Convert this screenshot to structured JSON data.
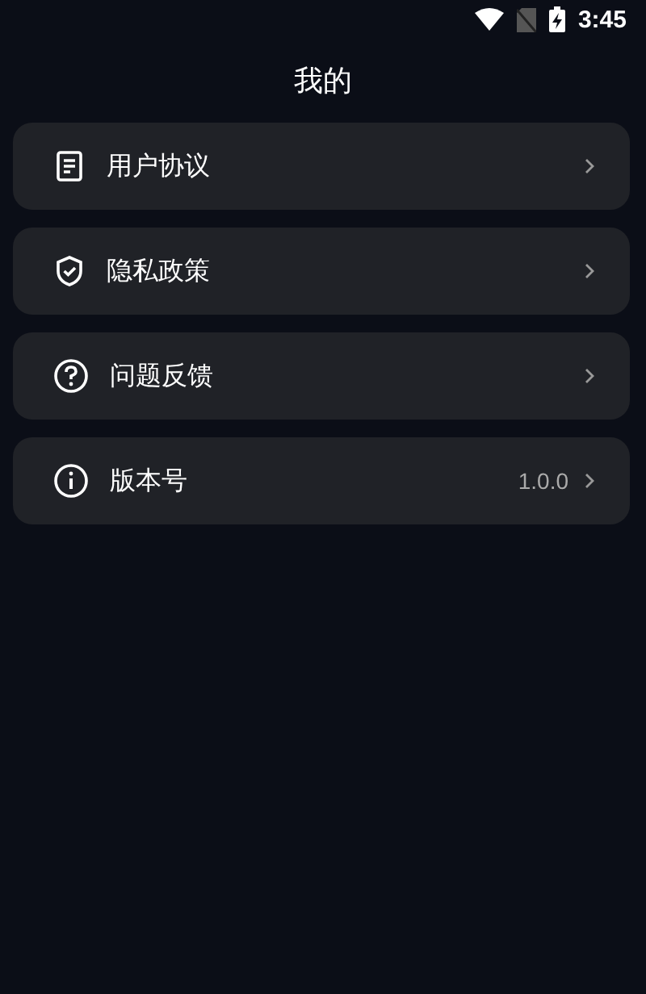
{
  "status_bar": {
    "time": "3:45"
  },
  "header": {
    "title": "我的"
  },
  "menu": [
    {
      "kind": "document",
      "label": "用户协议"
    },
    {
      "kind": "shield",
      "label": "隐私政策"
    },
    {
      "kind": "question",
      "label": "问题反馈"
    },
    {
      "kind": "info",
      "label": "版本号",
      "value": "1.0.0"
    }
  ]
}
